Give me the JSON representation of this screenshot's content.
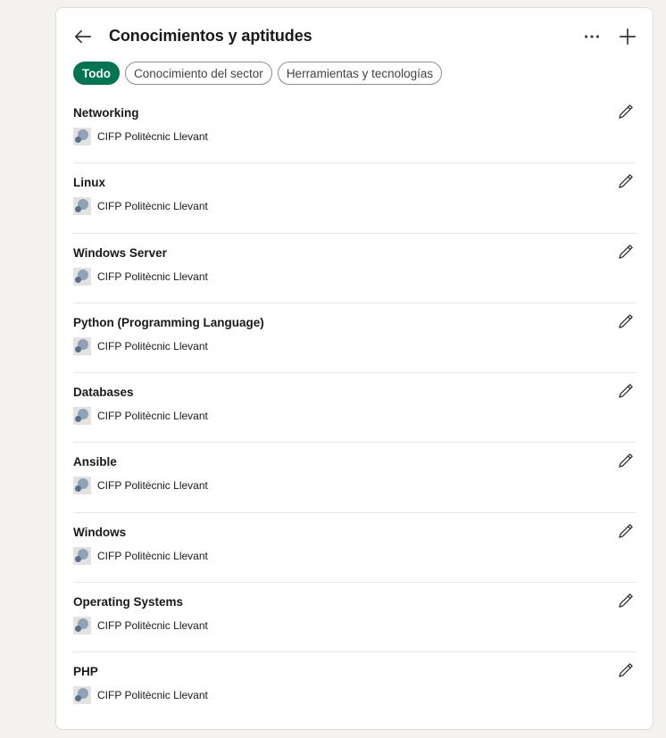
{
  "header": {
    "title": "Conocimientos y aptitudes",
    "back_icon": "arrow-left-icon",
    "more_icon": "ellipsis-icon",
    "add_icon": "plus-icon"
  },
  "filters": [
    {
      "label": "Todo",
      "active": true
    },
    {
      "label": "Conocimiento del sector",
      "active": false
    },
    {
      "label": "Herramientas y tecnologías",
      "active": false
    }
  ],
  "colors": {
    "accent": "#01754f",
    "background": "#f4f2ee",
    "card": "#ffffff"
  },
  "skills": [
    {
      "name": "Networking",
      "org": "CIFP Politècnic Llevant"
    },
    {
      "name": "Linux",
      "org": "CIFP Politècnic Llevant"
    },
    {
      "name": "Windows Server",
      "org": "CIFP Politècnic Llevant"
    },
    {
      "name": "Python (Programming Language)",
      "org": "CIFP Politècnic Llevant"
    },
    {
      "name": "Databases",
      "org": "CIFP Politècnic Llevant"
    },
    {
      "name": "Ansible",
      "org": "CIFP Politècnic Llevant"
    },
    {
      "name": "Windows",
      "org": "CIFP Politècnic Llevant"
    },
    {
      "name": "Operating Systems",
      "org": "CIFP Politècnic Llevant"
    },
    {
      "name": "PHP",
      "org": "CIFP Politècnic Llevant"
    }
  ]
}
